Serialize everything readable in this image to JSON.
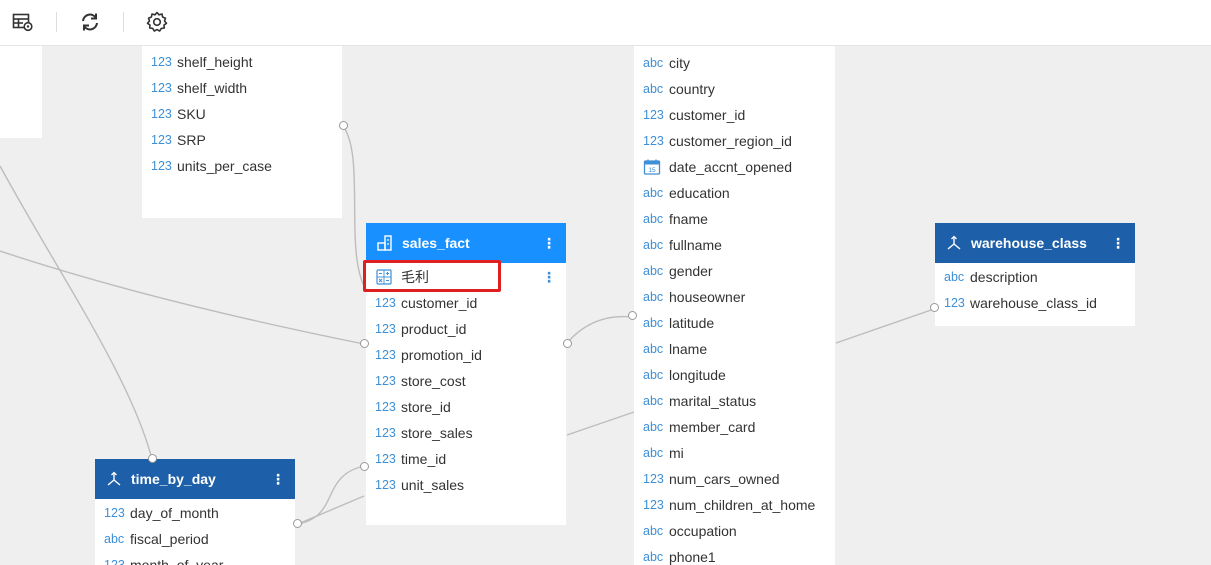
{
  "toolbar": {
    "icons": [
      "table-settings-icon",
      "refresh-icon",
      "gear-icon"
    ]
  },
  "colors": {
    "header_blue": "#1d5fa8",
    "header_active": "#1890ff",
    "type_blue": "#3d8fd6",
    "highlight_red": "#e02020"
  },
  "product_table": {
    "fields": [
      {
        "type": "123",
        "name": "shelf_height"
      },
      {
        "type": "123",
        "name": "shelf_width"
      },
      {
        "type": "123",
        "name": "SKU"
      },
      {
        "type": "123",
        "name": "SRP"
      },
      {
        "type": "123",
        "name": "units_per_case"
      }
    ]
  },
  "sales_fact": {
    "title": "sales_fact",
    "fields": [
      {
        "type": "calc",
        "name": "毛利"
      },
      {
        "type": "123",
        "name": "customer_id"
      },
      {
        "type": "123",
        "name": "product_id"
      },
      {
        "type": "123",
        "name": "promotion_id"
      },
      {
        "type": "123",
        "name": "store_cost"
      },
      {
        "type": "123",
        "name": "store_id"
      },
      {
        "type": "123",
        "name": "store_sales"
      },
      {
        "type": "123",
        "name": "time_id"
      },
      {
        "type": "123",
        "name": "unit_sales"
      }
    ]
  },
  "customer_table": {
    "fields": [
      {
        "type": "abc",
        "name": "city"
      },
      {
        "type": "abc",
        "name": "country"
      },
      {
        "type": "123",
        "name": "customer_id"
      },
      {
        "type": "123",
        "name": "customer_region_id"
      },
      {
        "type": "date",
        "name": "date_accnt_opened"
      },
      {
        "type": "abc",
        "name": "education"
      },
      {
        "type": "abc",
        "name": "fname"
      },
      {
        "type": "abc",
        "name": "fullname"
      },
      {
        "type": "abc",
        "name": "gender"
      },
      {
        "type": "abc",
        "name": "houseowner"
      },
      {
        "type": "abc",
        "name": "latitude"
      },
      {
        "type": "abc",
        "name": "lname"
      },
      {
        "type": "abc",
        "name": "longitude"
      },
      {
        "type": "abc",
        "name": "marital_status"
      },
      {
        "type": "abc",
        "name": "member_card"
      },
      {
        "type": "abc",
        "name": "mi"
      },
      {
        "type": "123",
        "name": "num_cars_owned"
      },
      {
        "type": "123",
        "name": "num_children_at_home"
      },
      {
        "type": "abc",
        "name": "occupation"
      },
      {
        "type": "abc",
        "name": "phone1"
      }
    ]
  },
  "warehouse_class": {
    "title": "warehouse_class",
    "fields": [
      {
        "type": "abc",
        "name": "description"
      },
      {
        "type": "123",
        "name": "warehouse_class_id"
      }
    ]
  },
  "time_by_day": {
    "title": "time_by_day",
    "fields": [
      {
        "type": "123",
        "name": "day_of_month"
      },
      {
        "type": "abc",
        "name": "fiscal_period"
      },
      {
        "type": "123",
        "name": "month_of_year"
      }
    ]
  }
}
